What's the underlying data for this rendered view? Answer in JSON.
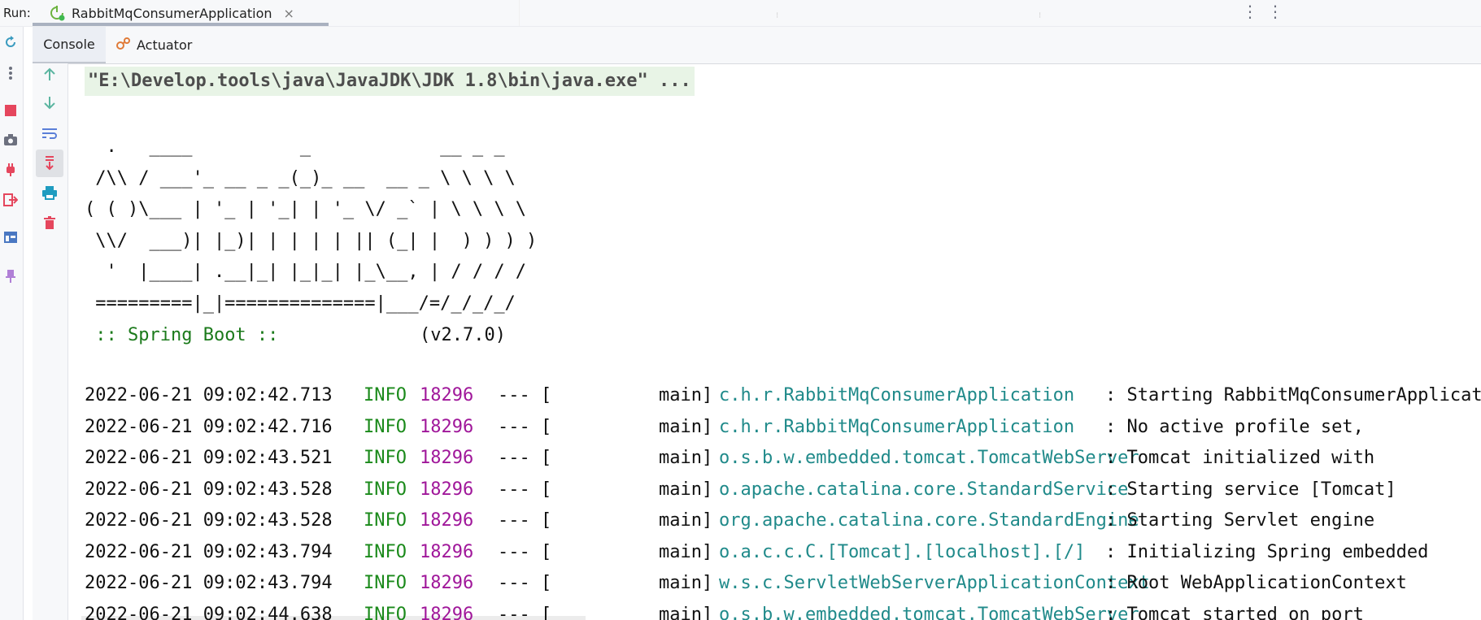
{
  "run_header": {
    "label": "Run:",
    "tab_title": "RabbitMqConsumerApplication",
    "close_symbol": "×",
    "more_symbol": "⋮"
  },
  "subtabs": [
    {
      "label": "Console",
      "active": true
    },
    {
      "label": "Actuator",
      "icon": "actuator-icon",
      "active": false
    }
  ],
  "left_toolbar": [
    {
      "name": "rerun-icon",
      "color": "#3a9bbf"
    },
    {
      "name": "more-vert-icon",
      "color": "#6c707e"
    },
    {
      "name": "stop-icon",
      "color": "#e5465d"
    },
    {
      "name": "camera-icon",
      "color": "#6c707e"
    },
    {
      "name": "plug-icon",
      "color": "#e5465d"
    },
    {
      "name": "exit-icon",
      "color": "#e5465d"
    },
    {
      "name": "layout-icon",
      "color": "#4a78c2"
    },
    {
      "name": "pin-icon",
      "color": "#b07fd6"
    }
  ],
  "console_toolbar": [
    {
      "name": "up-arrow-icon",
      "color": "#5ab5a0"
    },
    {
      "name": "down-arrow-icon",
      "color": "#5ab5a0"
    },
    {
      "name": "soft-wrap-icon",
      "color": "#5b7fd8"
    },
    {
      "name": "scroll-to-end-icon",
      "color": "#e5465d",
      "selected": true
    },
    {
      "name": "print-icon",
      "color": "#1f9cc0"
    },
    {
      "name": "trash-icon",
      "color": "#e5465d"
    }
  ],
  "console": {
    "command_line": "\"E:\\Develop.tools\\java\\JavaJDK\\JDK 1.8\\bin\\java.exe\" ...",
    "banner": "  .   ____          _            __ _ _\n /\\\\ / ___'_ __ _ _(_)_ __  __ _ \\ \\ \\ \\\n( ( )\\___ | '_ | '_| | '_ \\/ _` | \\ \\ \\ \\\n \\\\/  ___)| |_)| | | | | || (_| |  ) ) ) )\n  '  |____| .__|_| |_|_| |_\\__, | / / / /\n =========|_|==============|___/=/_/_/_/",
    "spring_prefix": " ",
    "spring_name": ":: Spring Boot ::",
    "spring_version": "(v2.7.0)",
    "logs": [
      {
        "ts": "2022-06-21 09:02:42.713",
        "level": "INFO",
        "pid": "18296",
        "sep": "--- [",
        "thread": "main]",
        "logger": "c.h.r.RabbitMqConsumerApplication",
        "msg": ": Starting RabbitMqConsumerApplication"
      },
      {
        "ts": "2022-06-21 09:02:42.716",
        "level": "INFO",
        "pid": "18296",
        "sep": "--- [",
        "thread": "main]",
        "logger": "c.h.r.RabbitMqConsumerApplication",
        "msg": ": No active profile set,"
      },
      {
        "ts": "2022-06-21 09:02:43.521",
        "level": "INFO",
        "pid": "18296",
        "sep": "--- [",
        "thread": "main]",
        "logger": "o.s.b.w.embedded.tomcat.TomcatWebServer",
        "msg": ": Tomcat initialized with"
      },
      {
        "ts": "2022-06-21 09:02:43.528",
        "level": "INFO",
        "pid": "18296",
        "sep": "--- [",
        "thread": "main]",
        "logger": "o.apache.catalina.core.StandardService",
        "msg": ": Starting service [Tomcat]"
      },
      {
        "ts": "2022-06-21 09:02:43.528",
        "level": "INFO",
        "pid": "18296",
        "sep": "--- [",
        "thread": "main]",
        "logger": "org.apache.catalina.core.StandardEngine",
        "msg": ": Starting Servlet engine"
      },
      {
        "ts": "2022-06-21 09:02:43.794",
        "level": "INFO",
        "pid": "18296",
        "sep": "--- [",
        "thread": "main]",
        "logger": "o.a.c.c.C.[Tomcat].[localhost].[/]",
        "msg": ": Initializing Spring embedded"
      },
      {
        "ts": "2022-06-21 09:02:43.794",
        "level": "INFO",
        "pid": "18296",
        "sep": "--- [",
        "thread": "main]",
        "logger": "w.s.c.ServletWebServerApplicationContext",
        "msg": ": Root WebApplicationContext"
      },
      {
        "ts": "2022-06-21 09:02:44.638",
        "level": "INFO",
        "pid": "18296",
        "sep": "--- [",
        "thread": "main]",
        "logger": "o.s.b.w.embedded.tomcat.TomcatWebServer",
        "msg": ": Tomcat started on port"
      }
    ]
  }
}
